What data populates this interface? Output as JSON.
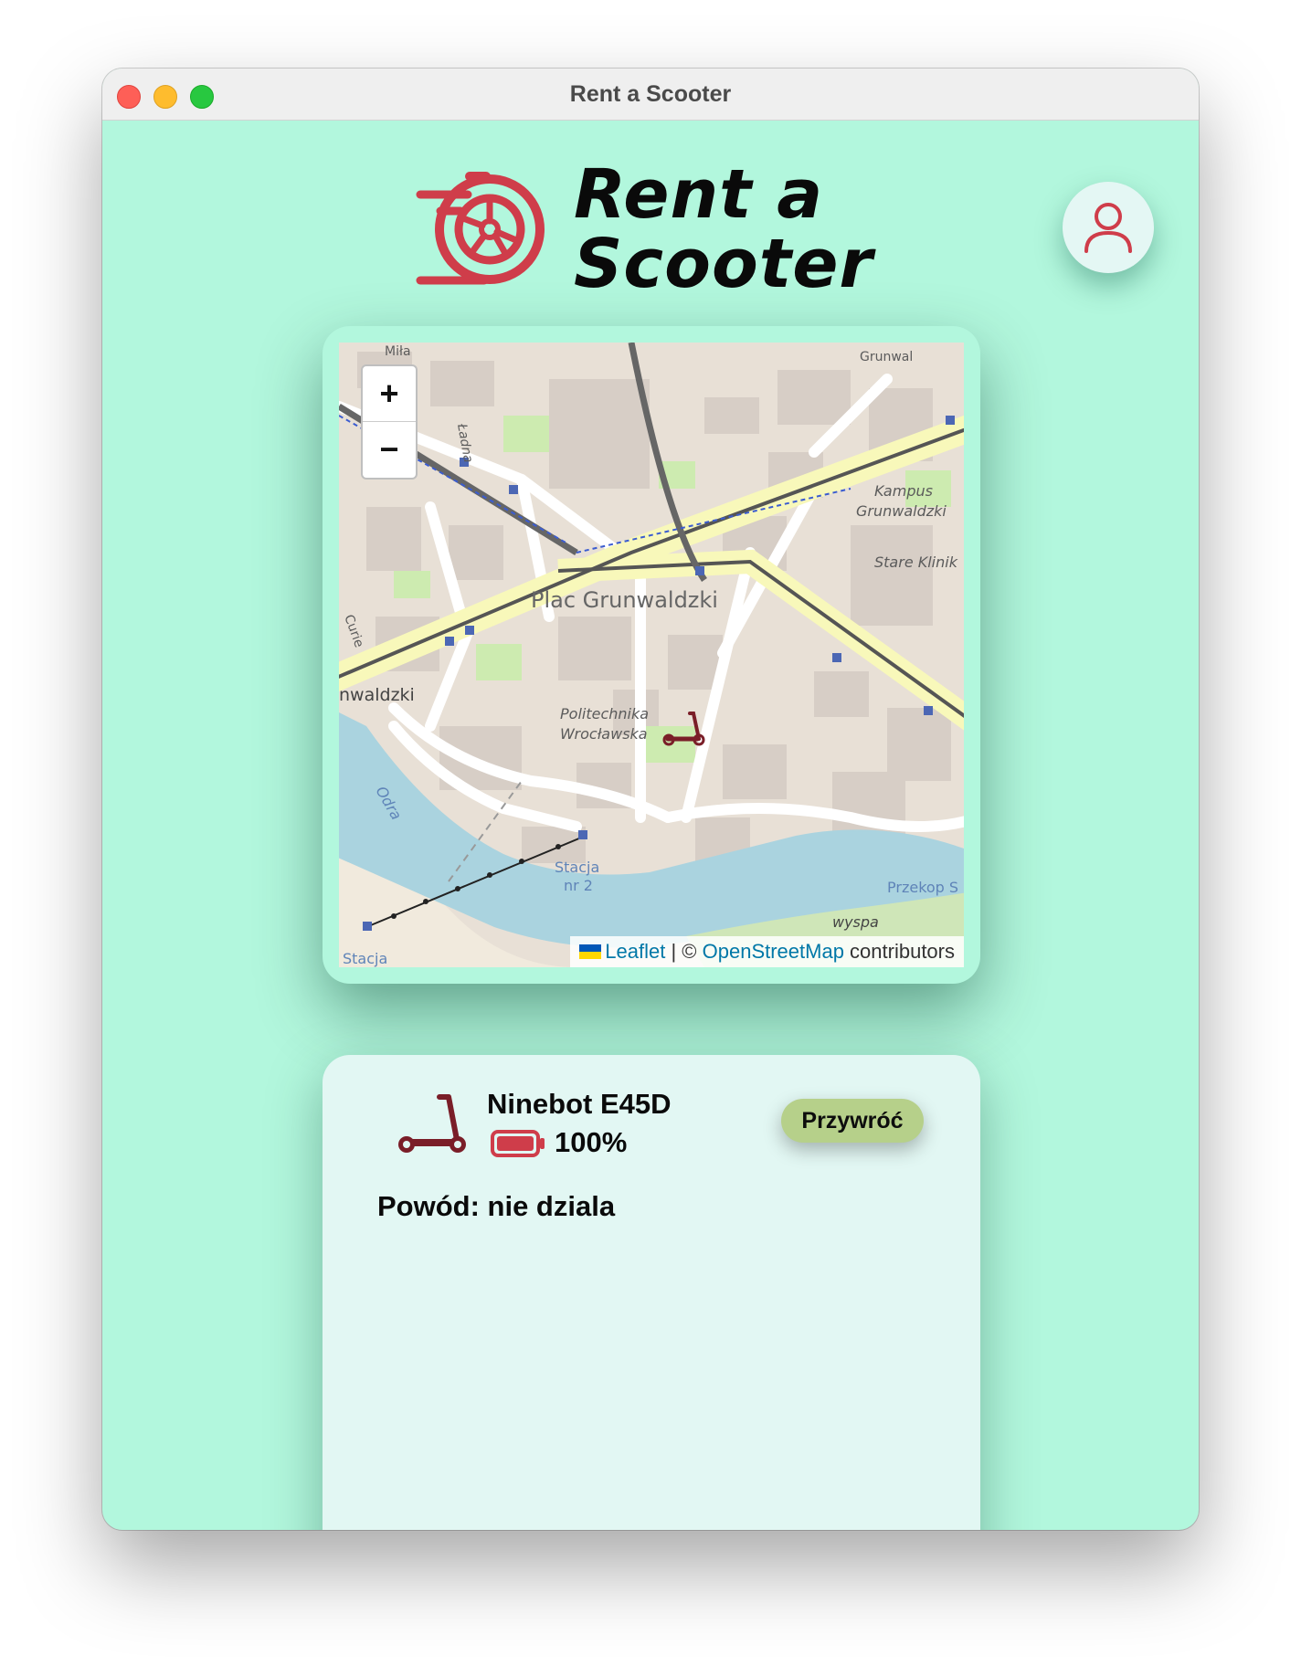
{
  "window": {
    "title": "Rent a Scooter"
  },
  "logo": {
    "line1": "Rent a",
    "line2": "Scooter"
  },
  "colors": {
    "background": "#b2f7dd",
    "brand_red": "#cf3d4a",
    "restore_button": "#b6d08a",
    "card": "#e2f7f3"
  },
  "map": {
    "zoom_in": "+",
    "zoom_out": "−",
    "labels": {
      "plac": "Plac Grunwaldzki",
      "grunwaldzki_west": "nwaldzki",
      "kampus1": "Kampus",
      "kampus2": "Grunwaldzki",
      "stare": "Stare Klinik",
      "poli1": "Politechnika",
      "poli2": "Wrocławska",
      "odra": "Odra",
      "stacja_nr": "Stacja",
      "nr2": "nr 2",
      "przekop": "Przekop S",
      "wyspa": "wyspa",
      "stacja_bottom": "Stacja",
      "ladna": "Ładna",
      "grunwal_top": "Grunwal",
      "curie": "Curie",
      "mila": "Miła"
    },
    "attribution": {
      "leaflet": "Leaflet",
      "separator": " | © ",
      "osm": "OpenStreetMap",
      "contributors": " contributors"
    }
  },
  "scooter": {
    "model": "Ninebot E45D",
    "battery_text": "100%",
    "battery_level": 1.0,
    "reason": "Powód: nie dziala",
    "restore_label": "Przywróć"
  }
}
